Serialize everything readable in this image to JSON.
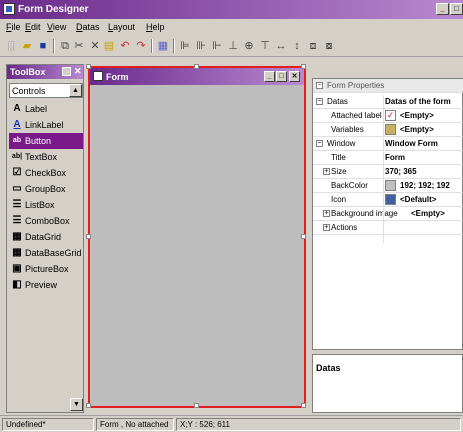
{
  "app": {
    "title": "Form Designer"
  },
  "menu": [
    "File",
    "Edit",
    "View",
    "Datas",
    "Layout",
    "Help"
  ],
  "toolbox": {
    "title": "ToolBox",
    "category": "Controls",
    "items": [
      {
        "label": "Label",
        "icon": "label-icon",
        "glyph": "A"
      },
      {
        "label": "LinkLabel",
        "icon": "link-label-icon",
        "glyph": "A"
      },
      {
        "label": "Button",
        "icon": "button-icon",
        "glyph": "ab",
        "selected": true
      },
      {
        "label": "TextBox",
        "icon": "textbox-icon",
        "glyph": "ab|"
      },
      {
        "label": "CheckBox",
        "icon": "checkbox-icon",
        "glyph": "☑"
      },
      {
        "label": "GroupBox",
        "icon": "groupbox-icon",
        "glyph": "▭"
      },
      {
        "label": "ListBox",
        "icon": "listbox-icon",
        "glyph": "☰"
      },
      {
        "label": "ComboBox",
        "icon": "combobox-icon",
        "glyph": "☰"
      },
      {
        "label": "DataGrid",
        "icon": "datagrid-icon",
        "glyph": "▦"
      },
      {
        "label": "DataBaseGrid",
        "icon": "database-grid-icon",
        "glyph": "▦"
      },
      {
        "label": "PictureBox",
        "icon": "picturebox-icon",
        "glyph": "▣"
      },
      {
        "label": "Preview",
        "icon": "preview-icon",
        "glyph": "◧"
      }
    ]
  },
  "form": {
    "title": "Form"
  },
  "properties": {
    "header": "Form Properties",
    "datas": {
      "label": "Datas",
      "value": "Datas of the form"
    },
    "attached_label": {
      "label": "Attached label",
      "value": "<Empty>"
    },
    "variables": {
      "label": "Variables",
      "value": "<Empty>"
    },
    "window": {
      "label": "Window",
      "value": "Window Form"
    },
    "title": {
      "label": "Title",
      "value": "Form"
    },
    "size": {
      "label": "Size",
      "value": "370; 365"
    },
    "backcolor": {
      "label": "BackColor",
      "value": "192; 192; 192",
      "color": "#c0c0c0"
    },
    "icon": {
      "label": "Icon",
      "value": "<Default>"
    },
    "background_image": {
      "label": "Background image",
      "value": "<Empty>"
    },
    "actions": {
      "label": "Actions"
    }
  },
  "description": {
    "title": "Datas"
  },
  "status": {
    "left": "Undefined*",
    "middle": "Form , No attached label",
    "coords": "X;Y : 526; 611"
  },
  "colors": {
    "accent": "#7a1a8a",
    "selection_border": "#e02020"
  }
}
